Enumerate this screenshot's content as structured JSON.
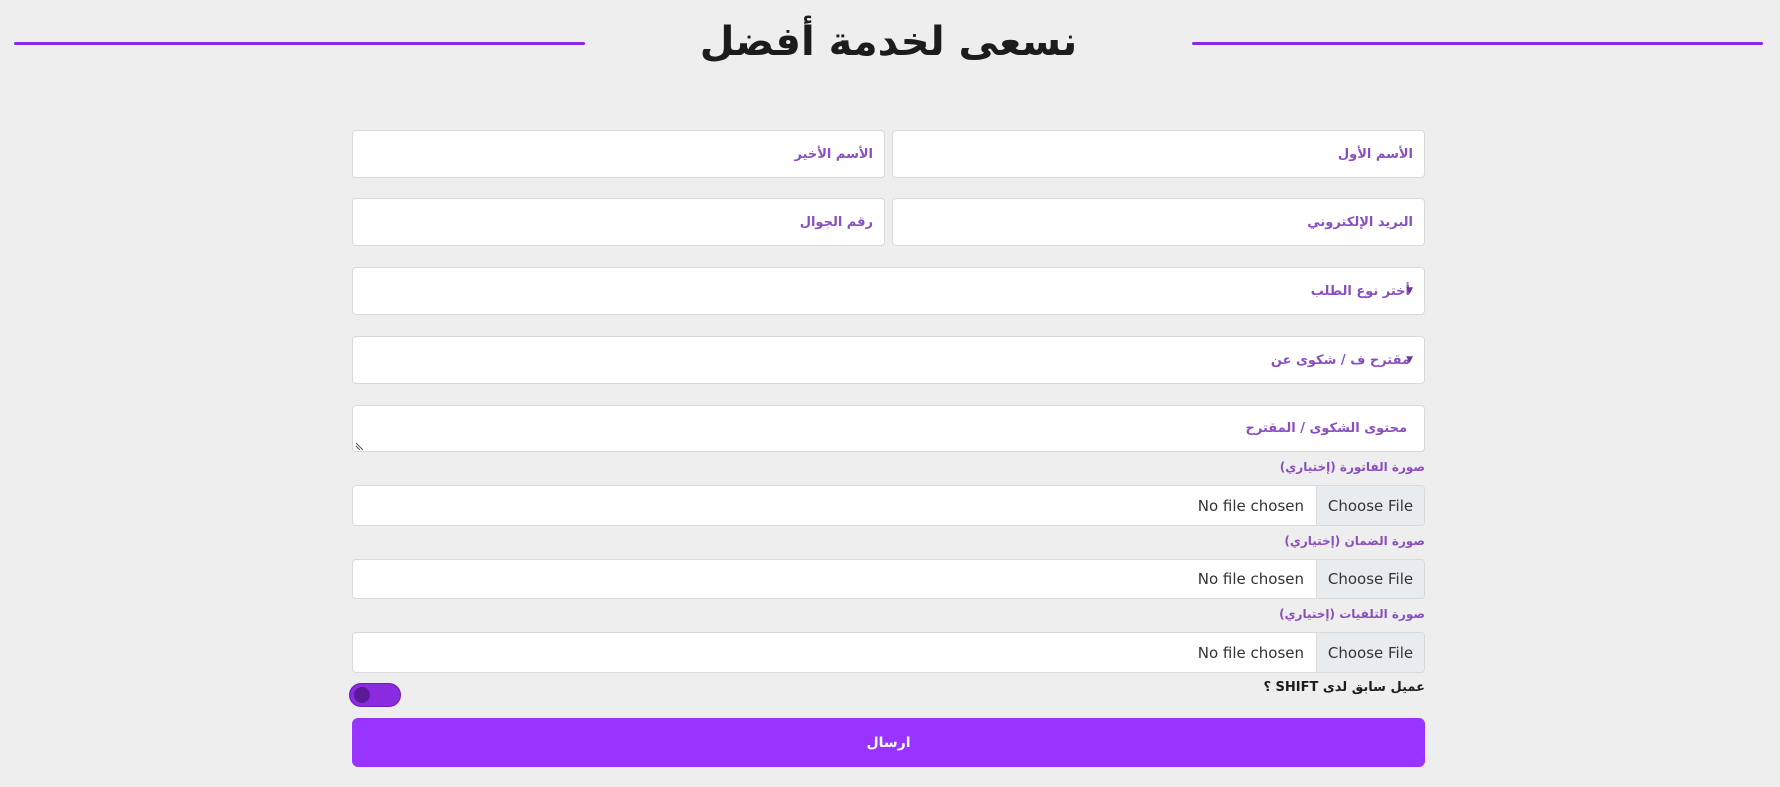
{
  "header": {
    "title": "نسعى لخدمة أفضل",
    "accent_color": "#8a2be2"
  },
  "form": {
    "first_name_placeholder": "الأسم الأول",
    "last_name_placeholder": "الأسم الأخير",
    "email_placeholder": "البريد الإلكتروني",
    "mobile_placeholder": "رقم الجوال",
    "request_type_placeholder": "أختر نوع الطلب",
    "subject_placeholder": "مقترح ف / شكوى عن",
    "content_placeholder": "محتوى الشكوى / المقترح",
    "file_inputs": [
      {
        "label": "صورة الفاتورة (إختياري)",
        "button": "Choose File",
        "status": "No file chosen"
      },
      {
        "label": "صورة الضمان (إختياري)",
        "button": "Choose File",
        "status": "No file chosen"
      },
      {
        "label": "صورة التلفيات (إختياري)",
        "button": "Choose File",
        "status": "No file chosen"
      }
    ],
    "previous_customer_label": "عميل سابق لدى SHIFT ؟",
    "previous_customer_on": false,
    "submit_label": "ارسال",
    "submit_color": "#9933ff"
  }
}
